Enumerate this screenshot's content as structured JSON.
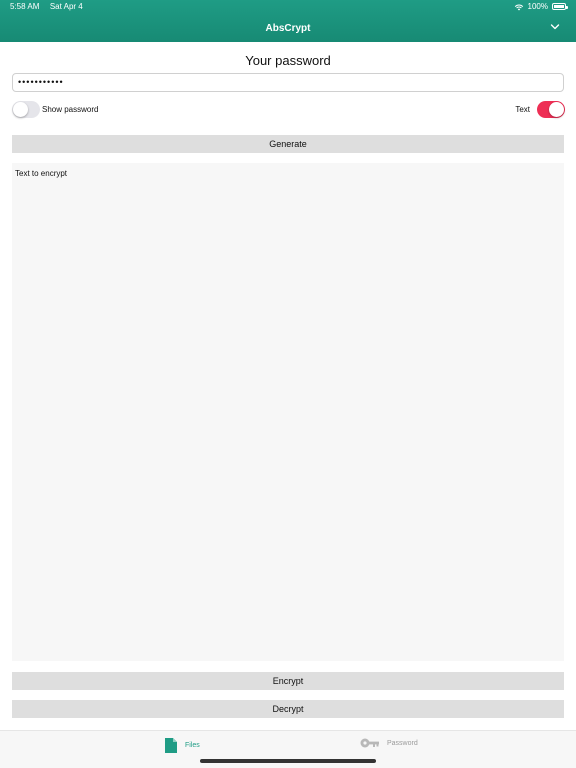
{
  "status_bar": {
    "time": "5:58 AM",
    "date": "Sat Apr 4",
    "battery": "100%"
  },
  "header": {
    "title": "AbsCrypt"
  },
  "password": {
    "heading": "Your password",
    "value": "•••••••••••",
    "show_label": "Show password",
    "text_label": "Text"
  },
  "buttons": {
    "generate": "Generate",
    "encrypt": "Encrypt",
    "decrypt": "Decrypt"
  },
  "text_area": {
    "placeholder": "Text to encrypt"
  },
  "tabs": [
    {
      "label": "Files"
    },
    {
      "label": "Password"
    }
  ],
  "colors": {
    "accent": "#1f9c85",
    "toggle_on": "#ee2f55"
  }
}
